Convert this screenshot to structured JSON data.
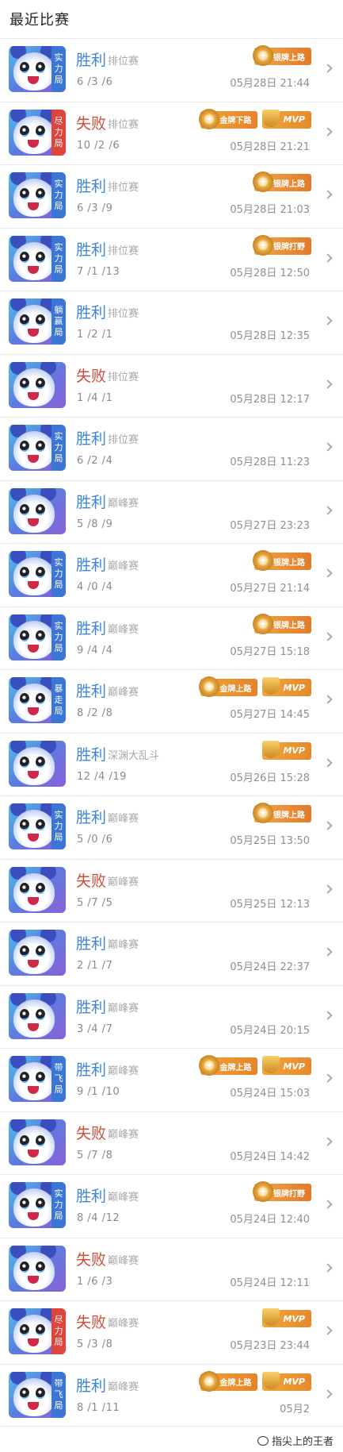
{
  "header": {
    "title": "最近比赛"
  },
  "matches": [
    {
      "result": "胜利",
      "outcome": "win",
      "mode": "排位赛",
      "kda": "6 /3 /6",
      "time": "05月28日 21:44",
      "tag": "实力局",
      "tag_color": "blue",
      "badges": [
        {
          "type": "silver",
          "label": "银牌上路"
        }
      ]
    },
    {
      "result": "失败",
      "outcome": "lose",
      "mode": "排位赛",
      "kda": "10 /2 /6",
      "time": "05月28日 21:21",
      "tag": "尽力局",
      "tag_color": "red",
      "badges": [
        {
          "type": "gold",
          "label": "金牌下路"
        },
        {
          "type": "mvp",
          "label": "MVP"
        }
      ]
    },
    {
      "result": "胜利",
      "outcome": "win",
      "mode": "排位赛",
      "kda": "6 /3 /9",
      "time": "05月28日 21:03",
      "tag": "实力局",
      "tag_color": "blue",
      "badges": [
        {
          "type": "silver",
          "label": "银牌上路"
        }
      ]
    },
    {
      "result": "胜利",
      "outcome": "win",
      "mode": "排位赛",
      "kda": "7 /1 /13",
      "time": "05月28日 12:50",
      "tag": "实力局",
      "tag_color": "blue",
      "badges": [
        {
          "type": "silver",
          "label": "银牌打野"
        }
      ]
    },
    {
      "result": "胜利",
      "outcome": "win",
      "mode": "排位赛",
      "kda": "1 /2 /1",
      "time": "05月28日 12:35",
      "tag": "躺赢局",
      "tag_color": "blue",
      "badges": []
    },
    {
      "result": "失败",
      "outcome": "lose",
      "mode": "排位赛",
      "kda": "1 /4 /1",
      "time": "05月28日 12:17",
      "tag": "",
      "tag_color": "",
      "badges": []
    },
    {
      "result": "胜利",
      "outcome": "win",
      "mode": "排位赛",
      "kda": "6 /2 /4",
      "time": "05月28日 11:23",
      "tag": "实力局",
      "tag_color": "blue",
      "badges": []
    },
    {
      "result": "胜利",
      "outcome": "win",
      "mode": "巅峰赛",
      "kda": "5 /8 /9",
      "time": "05月27日 23:23",
      "tag": "",
      "tag_color": "",
      "badges": []
    },
    {
      "result": "胜利",
      "outcome": "win",
      "mode": "巅峰赛",
      "kda": "4 /0 /4",
      "time": "05月27日 21:14",
      "tag": "实力局",
      "tag_color": "blue",
      "badges": [
        {
          "type": "silver",
          "label": "银牌上路"
        }
      ]
    },
    {
      "result": "胜利",
      "outcome": "win",
      "mode": "巅峰赛",
      "kda": "9 /4 /4",
      "time": "05月27日 15:18",
      "tag": "实力局",
      "tag_color": "blue",
      "badges": [
        {
          "type": "silver",
          "label": "银牌上路"
        }
      ]
    },
    {
      "result": "胜利",
      "outcome": "win",
      "mode": "巅峰赛",
      "kda": "8 /2 /8",
      "time": "05月27日 14:45",
      "tag": "暴走局",
      "tag_color": "blue",
      "badges": [
        {
          "type": "gold",
          "label": "金牌上路"
        },
        {
          "type": "mvp",
          "label": "MVP"
        }
      ]
    },
    {
      "result": "胜利",
      "outcome": "win",
      "mode": "深渊大乱斗",
      "kda": "12 /4 /19",
      "time": "05月26日 15:28",
      "tag": "",
      "tag_color": "",
      "badges": [
        {
          "type": "mvp",
          "label": "MVP"
        }
      ]
    },
    {
      "result": "胜利",
      "outcome": "win",
      "mode": "巅峰赛",
      "kda": "5 /0 /6",
      "time": "05月25日 13:50",
      "tag": "实力局",
      "tag_color": "blue",
      "badges": [
        {
          "type": "silver",
          "label": "银牌上路"
        }
      ]
    },
    {
      "result": "失败",
      "outcome": "lose",
      "mode": "巅峰赛",
      "kda": "5 /7 /5",
      "time": "05月25日 12:13",
      "tag": "",
      "tag_color": "",
      "badges": []
    },
    {
      "result": "胜利",
      "outcome": "win",
      "mode": "巅峰赛",
      "kda": "2 /1 /7",
      "time": "05月24日 22:37",
      "tag": "",
      "tag_color": "",
      "badges": []
    },
    {
      "result": "胜利",
      "outcome": "win",
      "mode": "巅峰赛",
      "kda": "3 /4 /7",
      "time": "05月24日 20:15",
      "tag": "",
      "tag_color": "",
      "badges": []
    },
    {
      "result": "胜利",
      "outcome": "win",
      "mode": "巅峰赛",
      "kda": "9 /1 /10",
      "time": "05月24日 15:03",
      "tag": "带飞局",
      "tag_color": "blue",
      "badges": [
        {
          "type": "gold",
          "label": "金牌上路"
        },
        {
          "type": "mvp",
          "label": "MVP"
        }
      ]
    },
    {
      "result": "失败",
      "outcome": "lose",
      "mode": "巅峰赛",
      "kda": "5 /7 /8",
      "time": "05月24日 14:42",
      "tag": "",
      "tag_color": "",
      "badges": []
    },
    {
      "result": "胜利",
      "outcome": "win",
      "mode": "巅峰赛",
      "kda": "8 /4 /12",
      "time": "05月24日 12:40",
      "tag": "实力局",
      "tag_color": "blue",
      "badges": [
        {
          "type": "silver",
          "label": "银牌打野"
        }
      ]
    },
    {
      "result": "失败",
      "outcome": "lose",
      "mode": "巅峰赛",
      "kda": "1 /6 /3",
      "time": "05月24日 12:11",
      "tag": "",
      "tag_color": "",
      "badges": []
    },
    {
      "result": "失败",
      "outcome": "lose",
      "mode": "巅峰赛",
      "kda": "5 /3 /8",
      "time": "05月23日 23:44",
      "tag": "尽力局",
      "tag_color": "red",
      "badges": [
        {
          "type": "mvp",
          "label": "MVP"
        }
      ]
    },
    {
      "result": "胜利",
      "outcome": "win",
      "mode": "巅峰赛",
      "kda": "8 /1 /11",
      "time": "05月2",
      "tag": "带飞局",
      "tag_color": "blue",
      "badges": [
        {
          "type": "gold",
          "label": "金牌上路"
        },
        {
          "type": "mvp",
          "label": "MVP"
        }
      ]
    }
  ],
  "watermark": {
    "text": "指尖上的王者"
  },
  "colors": {
    "win": "#3d86d6",
    "lose": "#d24b3a",
    "tag_blue": "#3b76d6",
    "tag_red": "#e0453b"
  },
  "icons": {
    "row_arrow": "chevron-right-icon",
    "avatar": "hero-avatar-icon",
    "medal": "medal-icon"
  }
}
